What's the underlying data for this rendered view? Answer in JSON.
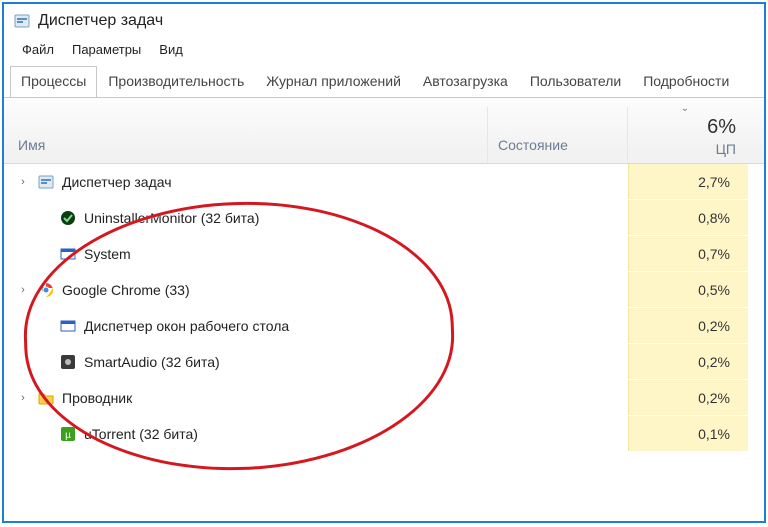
{
  "window": {
    "title": "Диспетчер задач"
  },
  "menu": {
    "file": "Файл",
    "options": "Параметры",
    "view": "Вид"
  },
  "tabs": {
    "processes": "Процессы",
    "performance": "Производительность",
    "apphistory": "Журнал приложений",
    "startup": "Автозагрузка",
    "users": "Пользователи",
    "details": "Подробности"
  },
  "columns": {
    "name": "Имя",
    "state": "Состояние",
    "cpu_label": "ЦП",
    "cpu_total": "6%"
  },
  "rows": [
    {
      "expand": true,
      "icon": "taskmgr",
      "name": "Диспетчер задач",
      "cpu": "2,7%"
    },
    {
      "expand": false,
      "icon": "green",
      "name": "UninstallerMonitor (32 бита)",
      "cpu": "0,8%"
    },
    {
      "expand": false,
      "icon": "win",
      "name": "System",
      "cpu": "0,7%"
    },
    {
      "expand": true,
      "icon": "chrome",
      "name": "Google Chrome (33)",
      "cpu": "0,5%"
    },
    {
      "expand": false,
      "icon": "win",
      "name": "Диспетчер окон рабочего стола",
      "cpu": "0,2%"
    },
    {
      "expand": false,
      "icon": "gray",
      "name": "SmartAudio (32 бита)",
      "cpu": "0,2%"
    },
    {
      "expand": true,
      "icon": "folder",
      "name": "Проводник",
      "cpu": "0,2%"
    },
    {
      "expand": false,
      "icon": "ut",
      "name": "uTorrent (32 бита)",
      "cpu": "0,1%"
    }
  ]
}
